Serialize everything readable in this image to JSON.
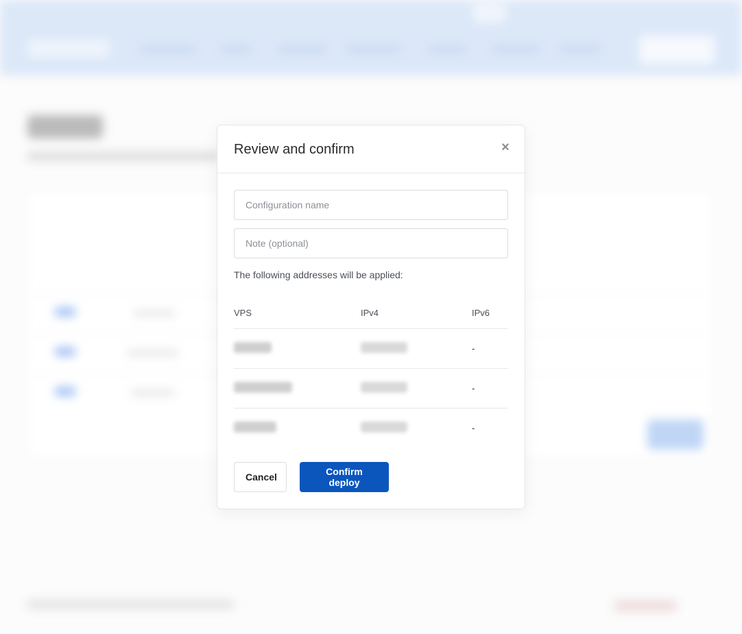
{
  "modal": {
    "title": "Review and confirm",
    "close_icon": "×",
    "config_name_placeholder": "Configuration name",
    "note_placeholder": "Note (optional)",
    "hint": "The following addresses will be applied:",
    "columns": [
      "VPS",
      "IPv4",
      "IPv6"
    ],
    "rows": [
      {
        "vps": "",
        "ipv4": "",
        "ipv6": "-"
      },
      {
        "vps": "",
        "ipv4": "",
        "ipv6": "-"
      },
      {
        "vps": "",
        "ipv4": "",
        "ipv6": "-"
      }
    ],
    "cancel_label": "Cancel",
    "confirm_label": "Confirm deploy"
  },
  "colors": {
    "primary": "#0b56bd",
    "header_bg": "#c9dcf5"
  }
}
